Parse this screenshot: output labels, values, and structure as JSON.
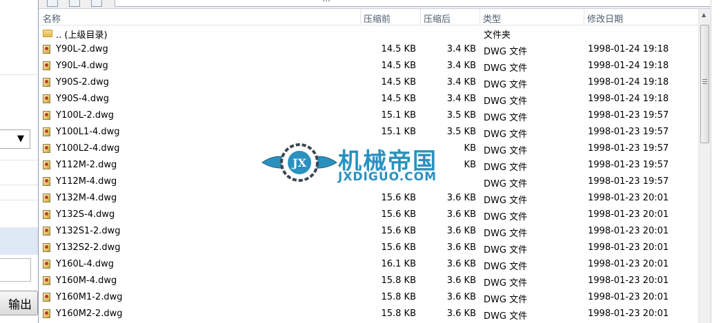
{
  "left_panel": {
    "select_arrow": "▼",
    "output_button_label": "输出"
  },
  "toolbar": {
    "path_text": "…"
  },
  "columns": {
    "name": "名称",
    "before": "压缩前",
    "after": "压缩后",
    "type": "类型",
    "modified": "修改日期"
  },
  "files": [
    {
      "icon": "folder-icon",
      "name": ".. (上级目录)",
      "before": "",
      "after": "",
      "type": "文件夹",
      "modified": ""
    },
    {
      "icon": "dwg-file-icon",
      "name": "Y90L-2.dwg",
      "before": "14.5 KB",
      "after": "3.4 KB",
      "type": "DWG 文件",
      "modified": "1998-01-24 19:18"
    },
    {
      "icon": "dwg-file-icon",
      "name": "Y90L-4.dwg",
      "before": "14.5 KB",
      "after": "3.4 KB",
      "type": "DWG 文件",
      "modified": "1998-01-24 19:18"
    },
    {
      "icon": "dwg-file-icon",
      "name": "Y90S-2.dwg",
      "before": "14.5 KB",
      "after": "3.4 KB",
      "type": "DWG 文件",
      "modified": "1998-01-24 19:18"
    },
    {
      "icon": "dwg-file-icon",
      "name": "Y90S-4.dwg",
      "before": "14.5 KB",
      "after": "3.4 KB",
      "type": "DWG 文件",
      "modified": "1998-01-24 19:18"
    },
    {
      "icon": "dwg-file-icon",
      "name": "Y100L-2.dwg",
      "before": "15.1 KB",
      "after": "3.5 KB",
      "type": "DWG 文件",
      "modified": "1998-01-23 19:57"
    },
    {
      "icon": "dwg-file-icon",
      "name": "Y100L1-4.dwg",
      "before": "15.1 KB",
      "after": "3.5 KB",
      "type": "DWG 文件",
      "modified": "1998-01-23 19:57"
    },
    {
      "icon": "dwg-file-icon",
      "name": "Y100L2-4.dwg",
      "before": "",
      "after": "KB",
      "type": "DWG 文件",
      "modified": "1998-01-23 19:57"
    },
    {
      "icon": "dwg-file-icon",
      "name": "Y112M-2.dwg",
      "before": "",
      "after": "KB",
      "type": "DWG 文件",
      "modified": "1998-01-23 19:57"
    },
    {
      "icon": "dwg-file-icon",
      "name": "Y112M-4.dwg",
      "before": "",
      "after": "",
      "type": "DWG 文件",
      "modified": "1998-01-23 19:57"
    },
    {
      "icon": "dwg-file-icon",
      "name": "Y132M-4.dwg",
      "before": "15.6 KB",
      "after": "3.6 KB",
      "type": "DWG 文件",
      "modified": "1998-01-23 20:01"
    },
    {
      "icon": "dwg-file-icon",
      "name": "Y132S-4.dwg",
      "before": "15.6 KB",
      "after": "3.6 KB",
      "type": "DWG 文件",
      "modified": "1998-01-23 20:01"
    },
    {
      "icon": "dwg-file-icon",
      "name": "Y132S1-2.dwg",
      "before": "15.6 KB",
      "after": "3.6 KB",
      "type": "DWG 文件",
      "modified": "1998-01-23 20:01"
    },
    {
      "icon": "dwg-file-icon",
      "name": "Y132S2-2.dwg",
      "before": "15.6 KB",
      "after": "3.6 KB",
      "type": "DWG 文件",
      "modified": "1998-01-23 20:01"
    },
    {
      "icon": "dwg-file-icon",
      "name": "Y160L-4.dwg",
      "before": "16.1 KB",
      "after": "3.6 KB",
      "type": "DWG 文件",
      "modified": "1998-01-23 20:01"
    },
    {
      "icon": "dwg-file-icon",
      "name": "Y160M-4.dwg",
      "before": "15.8 KB",
      "after": "3.6 KB",
      "type": "DWG 文件",
      "modified": "1998-01-23 20:01"
    },
    {
      "icon": "dwg-file-icon",
      "name": "Y160M1-2.dwg",
      "before": "15.8 KB",
      "after": "3.6 KB",
      "type": "DWG 文件",
      "modified": "1998-01-23 20:01"
    },
    {
      "icon": "dwg-file-icon",
      "name": "Y160M2-2.dwg",
      "before": "15.8 KB",
      "after": "3.6 KB",
      "type": "DWG 文件",
      "modified": "1998-01-23 20:01"
    }
  ],
  "watermark": {
    "title": "机械帝国",
    "url": "JXDIGUO.COM",
    "badge": "JX"
  },
  "colors": {
    "header_text": "#4c5d6e",
    "watermark_blue": "#2a91bf",
    "selection_band": "#dfe9f6"
  }
}
